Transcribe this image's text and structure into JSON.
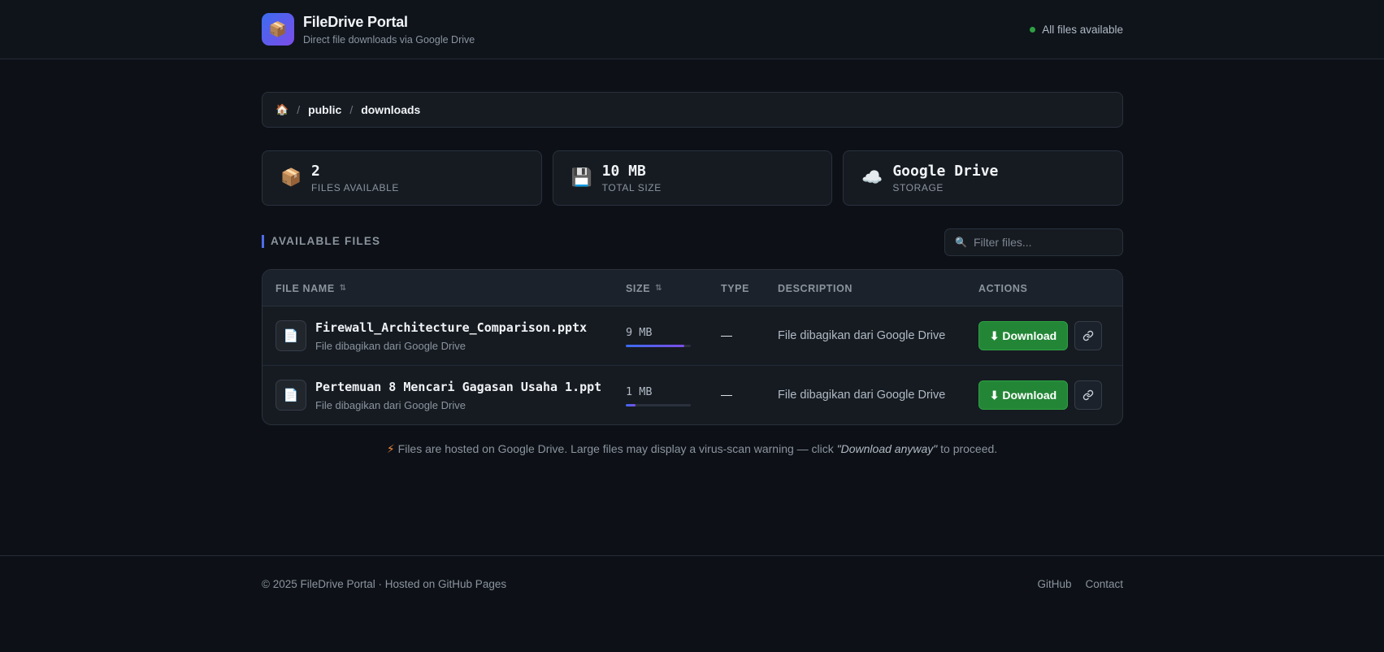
{
  "header": {
    "logo_emoji": "📦",
    "title": "FileDrive Portal",
    "subtitle": "Direct file downloads via Google Drive",
    "status_text": "All files available",
    "status_color": "#2ea043"
  },
  "breadcrumb": {
    "home_icon": "🏠",
    "sep": "/",
    "items": [
      "public",
      "downloads"
    ]
  },
  "stats": [
    {
      "icon": "📦",
      "value": "2",
      "label": "FILES AVAILABLE"
    },
    {
      "icon": "💾",
      "value": "10 MB",
      "label": "TOTAL SIZE"
    },
    {
      "icon": "☁️",
      "value": "Google Drive",
      "label": "STORAGE"
    }
  ],
  "section": {
    "title": "AVAILABLE FILES",
    "filter_placeholder": "Filter files...",
    "filter_icon": "🔍"
  },
  "table": {
    "columns": {
      "name": "FILE NAME",
      "size": "SIZE",
      "type": "TYPE",
      "description": "DESCRIPTION",
      "actions": "ACTIONS",
      "sort_icon": "⇅"
    },
    "rows": [
      {
        "icon": "📄",
        "name": "Firewall_Architecture_Comparison.pptx",
        "sub": "File dibagikan dari Google Drive",
        "size": "9 MB",
        "size_fraction": 0.9,
        "type": "—",
        "description": "File dibagikan dari Google Drive",
        "download_label": "⬇ Download"
      },
      {
        "icon": "📄",
        "name": "Pertemuan 8 Mencari Gagasan Usaha 1.ppt",
        "sub": "File dibagikan dari Google Drive",
        "size": "1 MB",
        "size_fraction": 0.15,
        "type": "—",
        "description": "File dibagikan dari Google Drive",
        "download_label": "⬇ Download"
      }
    ]
  },
  "note": {
    "icon": "⚡",
    "before": "Files are hosted on Google Drive. Large files may display a virus-scan warning — click ",
    "emphasis": "\"Download anyway\"",
    "after": " to proceed."
  },
  "footer": {
    "copyright": "© 2025 FileDrive Portal · Hosted on GitHub Pages",
    "links": [
      "GitHub",
      "Contact"
    ]
  }
}
